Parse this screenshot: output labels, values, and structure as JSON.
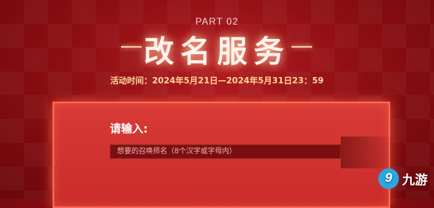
{
  "header": {
    "part_label": "PART 02",
    "title": "改名服务",
    "event_time": "活动时间：2024年5月21日—2024年5月31日23：59"
  },
  "form": {
    "label": "请输入:",
    "placeholder": "想要的召唤师名（8个汉字或字母内）"
  },
  "watermark": {
    "icon_text": "9",
    "text": "九游"
  },
  "colors": {
    "background": "#8f0f14",
    "panel": "#d83a36",
    "accent_text": "#ffd59a"
  }
}
